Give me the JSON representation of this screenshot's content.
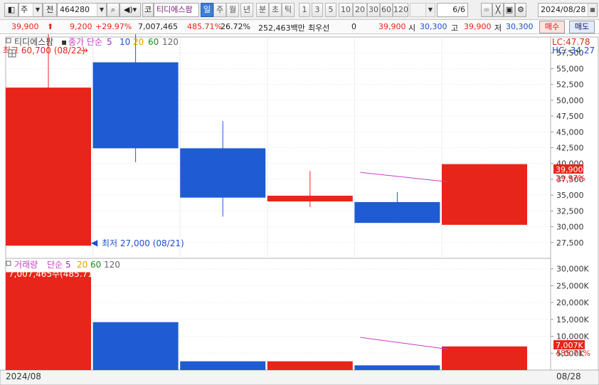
{
  "toolbar": {
    "period_code": "주",
    "market_code": "전",
    "stock_code": "464280",
    "badge": "코",
    "stock_name": "티디에스팜",
    "periods": [
      "일",
      "주",
      "월",
      "년",
      "분",
      "초",
      "틱"
    ],
    "selected_period": "일",
    "intervals": [
      "1",
      "3",
      "5",
      "10",
      "20",
      "30",
      "60",
      "120"
    ],
    "page_count": "6",
    "page_total": "/6",
    "date": "2024/08/28"
  },
  "quote": {
    "price": "39,900",
    "change": "9,200",
    "change_pct": "+29.97%",
    "volume": "7,007,465",
    "volume_pct": "485.71%",
    "turnover": "26.72%",
    "amount": "252,463백만",
    "preferred_label": "최우선",
    "preferred_value": "0",
    "bid": "39,900",
    "open_label": "시",
    "open": "30,300",
    "high_label": "고",
    "high": "39,900",
    "low_label": "저",
    "low": "30,300",
    "buy_label": "매수",
    "sell_label": "매도"
  },
  "price_panel": {
    "name": "티디에스팜",
    "ma_label": "종가 단순",
    "ma_periods": [
      "5",
      "10",
      "20",
      "60",
      "120"
    ],
    "ma_colors": [
      "#9b30c8",
      "#1f4fcf",
      "#e0a000",
      "#1a8a1a",
      "#666666"
    ],
    "lc": "LC:47.78",
    "hc": "HC:-34.27",
    "high_annotation": "최고 60,700 (08/22)",
    "low_annotation": "최저 27,000 (08/21)",
    "last_price_label": "39,900",
    "last_pct_label": "29.97%",
    "y_ticks": [
      "57,500",
      "55,000",
      "52,500",
      "50,000",
      "47,500",
      "45,000",
      "42,500",
      "40,000",
      "37,500",
      "35,000",
      "32,500",
      "30,000",
      "27,500"
    ]
  },
  "volume_panel": {
    "title": "거래량",
    "ma_label": "단순",
    "ma_periods": [
      "5",
      "20",
      "60",
      "120"
    ],
    "ma_colors": [
      "#9b30c8",
      "#e0a000",
      "#1a8a1a",
      "#666666"
    ],
    "volume_annotation": "7,007,465주(485.71%)",
    "last_volume_label": "7,007K",
    "last_pct_label": "485.71%",
    "y_ticks": [
      "30,000K",
      "25,000K",
      "20,000K",
      "15,000K",
      "10,000K",
      "5,000K"
    ]
  },
  "xaxis": {
    "left_label": "2024/08",
    "right_label": "08/28"
  },
  "colors": {
    "up": "#e8251a",
    "down": "#1f5bd3",
    "ma5": "#c83cc8"
  },
  "chart_data": {
    "type": "candlestick",
    "candles": [
      {
        "open": 52000,
        "high": 60700,
        "low": 27000,
        "close": 27000,
        "color": "up"
      },
      {
        "open": 56000,
        "high": 60700,
        "low": 40200,
        "close": 42400,
        "color": "down"
      },
      {
        "open": 42400,
        "high": 46700,
        "low": 31600,
        "close": 34600,
        "color": "down"
      },
      {
        "open": 34000,
        "high": 38800,
        "low": 33100,
        "close": 34900,
        "color": "up"
      },
      {
        "open": 33900,
        "high": 35500,
        "low": 30600,
        "close": 30600,
        "color": "down"
      },
      {
        "open": 30300,
        "high": 39900,
        "low": 30300,
        "close": 39900,
        "color": "up"
      }
    ],
    "volumes_k": [
      29000,
      14200,
      2600,
      2600,
      1400,
      7007
    ],
    "ma5_price": [
      {
        "index": 4.5,
        "value": 38600
      },
      {
        "index": 5.5,
        "value": 37100
      }
    ],
    "ma5_volume_k": [
      {
        "index": 4.5,
        "value": 9700
      },
      {
        "index": 5.5,
        "value": 6200
      }
    ],
    "price_axis": {
      "min": 25000,
      "max": 60000
    },
    "volume_axis_k": {
      "min": 0,
      "max": 31000
    }
  }
}
